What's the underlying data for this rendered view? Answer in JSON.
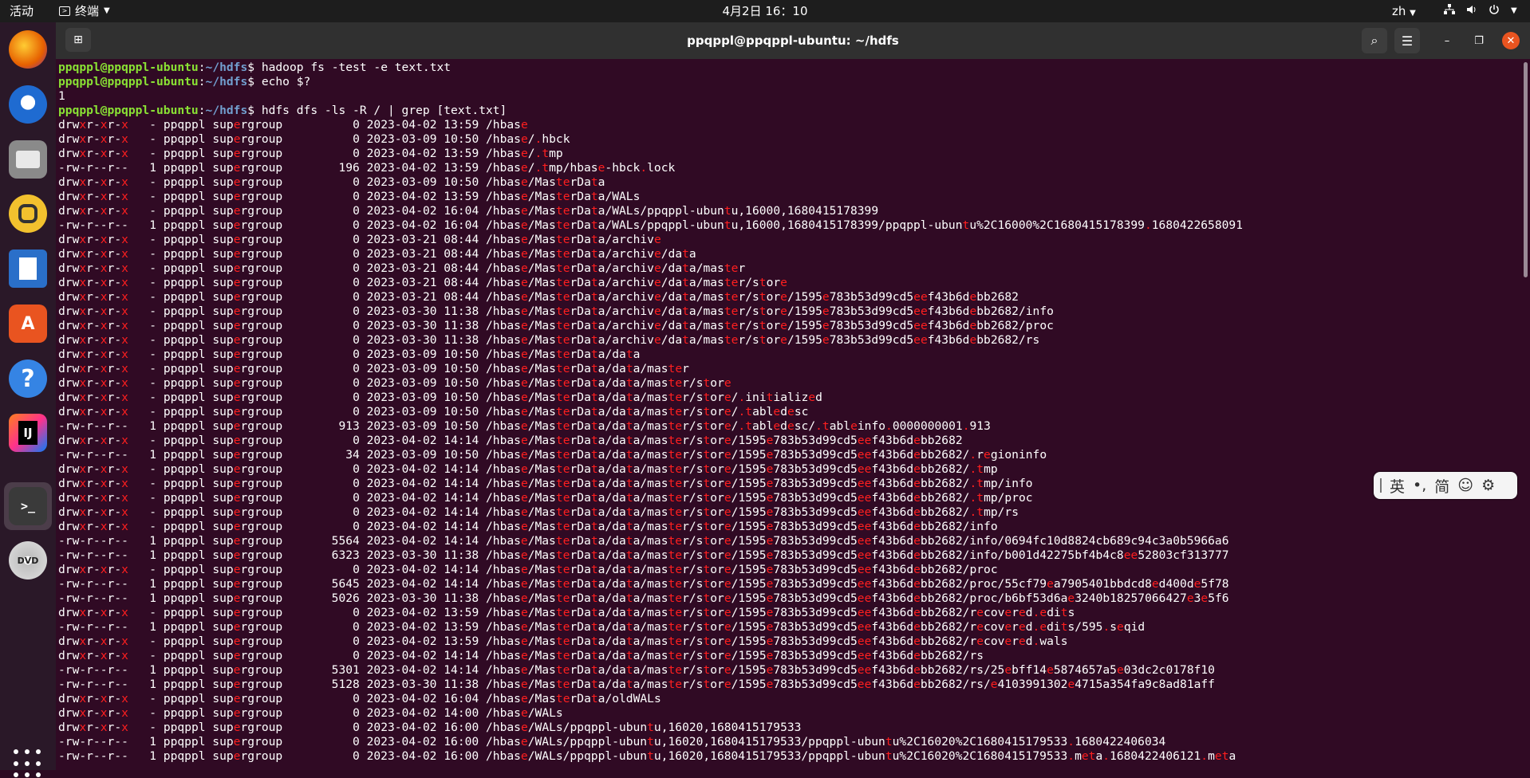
{
  "topbar": {
    "activities": "活动",
    "app_name": "终端",
    "clock": "4月2日 16：10",
    "lang": "zh",
    "tray_icons": [
      "network-icon",
      "volume-icon",
      "power-icon"
    ]
  },
  "dock": {
    "apps": [
      {
        "name": "firefox",
        "label": "",
        "color": "#e66000"
      },
      {
        "name": "thunderbird",
        "label": "",
        "color": "#1f6bd1"
      },
      {
        "name": "files",
        "label": "",
        "color": "#8a8a8a"
      },
      {
        "name": "rhythmbox",
        "label": "",
        "color": "#f2c12e"
      },
      {
        "name": "libreoffice-writer",
        "label": "",
        "color": "#2a6fc9"
      },
      {
        "name": "app-center",
        "label": "A",
        "color": "#e95420"
      },
      {
        "name": "help",
        "label": "?",
        "color": "#3584e4"
      },
      {
        "name": "intellij",
        "label": "IJ",
        "color": "#111111"
      },
      {
        "name": "terminal",
        "label": ">_",
        "color": "#3a3a3a"
      },
      {
        "name": "dvd",
        "label": "DVD",
        "color": "#bfbfbf"
      }
    ]
  },
  "window": {
    "title": "ppqppl@ppqppl-ubuntu: ~/hdfs",
    "buttons": {
      "minimize": "–",
      "maximize": "❐",
      "close": "✕",
      "search": "⌕",
      "menu": "☰",
      "new_tab": "⊞"
    }
  },
  "terminal": {
    "lines": [
      {
        "type": "prompt",
        "user": "ppqppl@ppqppl-ubuntu",
        "path": "~/hdfs",
        "cmd": "hadoop fs -test -e text.txt"
      },
      {
        "type": "prompt",
        "user": "ppqppl@ppqppl-ubuntu",
        "path": "~/hdfs",
        "cmd": "echo $?"
      },
      {
        "type": "out",
        "text": "1"
      },
      {
        "type": "prompt",
        "user": "ppqppl@ppqppl-ubuntu",
        "path": "~/hdfs",
        "cmd": "hdfs dfs -ls -R / | grep [text.txt]"
      },
      {
        "type": "out",
        "text": "drwxr-xr-x   - ppqppl supergroup          0 2023-04-02 13:59 /hbase"
      },
      {
        "type": "out",
        "text": "drwxr-xr-x   - ppqppl supergroup          0 2023-03-09 10:50 /hbase/.hbck"
      },
      {
        "type": "out",
        "text": "drwxr-xr-x   - ppqppl supergroup          0 2023-04-02 13:59 /hbase/.tmp"
      },
      {
        "type": "out",
        "text": "-rw-r--r--   1 ppqppl supergroup        196 2023-04-02 13:59 /hbase/.tmp/hbase-hbck.lock"
      },
      {
        "type": "out",
        "text": "drwxr-xr-x   - ppqppl supergroup          0 2023-03-09 10:50 /hbase/MasterData"
      },
      {
        "type": "out",
        "text": "drwxr-xr-x   - ppqppl supergroup          0 2023-04-02 13:59 /hbase/MasterData/WALs"
      },
      {
        "type": "out",
        "text": "drwxr-xr-x   - ppqppl supergroup          0 2023-04-02 16:04 /hbase/MasterData/WALs/ppqppl-ubuntu,16000,1680415178399"
      },
      {
        "type": "out",
        "text": "-rw-r--r--   1 ppqppl supergroup          0 2023-04-02 16:04 /hbase/MasterData/WALs/ppqppl-ubuntu,16000,1680415178399/ppqppl-ubuntu%2C16000%2C1680415178399.1680422658091"
      },
      {
        "type": "out",
        "text": "drwxr-xr-x   - ppqppl supergroup          0 2023-03-21 08:44 /hbase/MasterData/archive"
      },
      {
        "type": "out",
        "text": "drwxr-xr-x   - ppqppl supergroup          0 2023-03-21 08:44 /hbase/MasterData/archive/data"
      },
      {
        "type": "out",
        "text": "drwxr-xr-x   - ppqppl supergroup          0 2023-03-21 08:44 /hbase/MasterData/archive/data/master"
      },
      {
        "type": "out",
        "text": "drwxr-xr-x   - ppqppl supergroup          0 2023-03-21 08:44 /hbase/MasterData/archive/data/master/store"
      },
      {
        "type": "out",
        "text": "drwxr-xr-x   - ppqppl supergroup          0 2023-03-21 08:44 /hbase/MasterData/archive/data/master/store/1595e783b53d99cd5eef43b6debb2682"
      },
      {
        "type": "out",
        "text": "drwxr-xr-x   - ppqppl supergroup          0 2023-03-30 11:38 /hbase/MasterData/archive/data/master/store/1595e783b53d99cd5eef43b6debb2682/info"
      },
      {
        "type": "out",
        "text": "drwxr-xr-x   - ppqppl supergroup          0 2023-03-30 11:38 /hbase/MasterData/archive/data/master/store/1595e783b53d99cd5eef43b6debb2682/proc"
      },
      {
        "type": "out",
        "text": "drwxr-xr-x   - ppqppl supergroup          0 2023-03-30 11:38 /hbase/MasterData/archive/data/master/store/1595e783b53d99cd5eef43b6debb2682/rs"
      },
      {
        "type": "out",
        "text": "drwxr-xr-x   - ppqppl supergroup          0 2023-03-09 10:50 /hbase/MasterData/data"
      },
      {
        "type": "out",
        "text": "drwxr-xr-x   - ppqppl supergroup          0 2023-03-09 10:50 /hbase/MasterData/data/master"
      },
      {
        "type": "out",
        "text": "drwxr-xr-x   - ppqppl supergroup          0 2023-03-09 10:50 /hbase/MasterData/data/master/store"
      },
      {
        "type": "out",
        "text": "drwxr-xr-x   - ppqppl supergroup          0 2023-03-09 10:50 /hbase/MasterData/data/master/store/.initialized"
      },
      {
        "type": "out",
        "text": "drwxr-xr-x   - ppqppl supergroup          0 2023-03-09 10:50 /hbase/MasterData/data/master/store/.tabledesc"
      },
      {
        "type": "out",
        "text": "-rw-r--r--   1 ppqppl supergroup        913 2023-03-09 10:50 /hbase/MasterData/data/master/store/.tabledesc/.tableinfo.0000000001.913"
      },
      {
        "type": "out",
        "text": "drwxr-xr-x   - ppqppl supergroup          0 2023-04-02 14:14 /hbase/MasterData/data/master/store/1595e783b53d99cd5eef43b6debb2682"
      },
      {
        "type": "out",
        "text": "-rw-r--r--   1 ppqppl supergroup         34 2023-03-09 10:50 /hbase/MasterData/data/master/store/1595e783b53d99cd5eef43b6debb2682/.regioninfo"
      },
      {
        "type": "out",
        "text": "drwxr-xr-x   - ppqppl supergroup          0 2023-04-02 14:14 /hbase/MasterData/data/master/store/1595e783b53d99cd5eef43b6debb2682/.tmp"
      },
      {
        "type": "out",
        "text": "drwxr-xr-x   - ppqppl supergroup          0 2023-04-02 14:14 /hbase/MasterData/data/master/store/1595e783b53d99cd5eef43b6debb2682/.tmp/info"
      },
      {
        "type": "out",
        "text": "drwxr-xr-x   - ppqppl supergroup          0 2023-04-02 14:14 /hbase/MasterData/data/master/store/1595e783b53d99cd5eef43b6debb2682/.tmp/proc"
      },
      {
        "type": "out",
        "text": "drwxr-xr-x   - ppqppl supergroup          0 2023-04-02 14:14 /hbase/MasterData/data/master/store/1595e783b53d99cd5eef43b6debb2682/.tmp/rs"
      },
      {
        "type": "out",
        "text": "drwxr-xr-x   - ppqppl supergroup          0 2023-04-02 14:14 /hbase/MasterData/data/master/store/1595e783b53d99cd5eef43b6debb2682/info"
      },
      {
        "type": "out",
        "text": "-rw-r--r--   1 ppqppl supergroup       5564 2023-04-02 14:14 /hbase/MasterData/data/master/store/1595e783b53d99cd5eef43b6debb2682/info/0694fc10d8824cb689c94c3a0b5966a6"
      },
      {
        "type": "out",
        "text": "-rw-r--r--   1 ppqppl supergroup       6323 2023-03-30 11:38 /hbase/MasterData/data/master/store/1595e783b53d99cd5eef43b6debb2682/info/b001d42275bf4b4c8ee52803cf313777"
      },
      {
        "type": "out",
        "text": "drwxr-xr-x   - ppqppl supergroup          0 2023-04-02 14:14 /hbase/MasterData/data/master/store/1595e783b53d99cd5eef43b6debb2682/proc"
      },
      {
        "type": "out",
        "text": "-rw-r--r--   1 ppqppl supergroup       5645 2023-04-02 14:14 /hbase/MasterData/data/master/store/1595e783b53d99cd5eef43b6debb2682/proc/55cf79ea7905401bbdcd8ed400de5f78"
      },
      {
        "type": "out",
        "text": "-rw-r--r--   1 ppqppl supergroup       5026 2023-03-30 11:38 /hbase/MasterData/data/master/store/1595e783b53d99cd5eef43b6debb2682/proc/b6bf53d6ae3240b18257066427e3e5f6"
      },
      {
        "type": "out",
        "text": "drwxr-xr-x   - ppqppl supergroup          0 2023-04-02 13:59 /hbase/MasterData/data/master/store/1595e783b53d99cd5eef43b6debb2682/recovered.edits"
      },
      {
        "type": "out",
        "text": "-rw-r--r--   1 ppqppl supergroup          0 2023-04-02 13:59 /hbase/MasterData/data/master/store/1595e783b53d99cd5eef43b6debb2682/recovered.edits/595.seqid"
      },
      {
        "type": "out",
        "text": "drwxr-xr-x   - ppqppl supergroup          0 2023-04-02 13:59 /hbase/MasterData/data/master/store/1595e783b53d99cd5eef43b6debb2682/recovered.wals"
      },
      {
        "type": "out",
        "text": "drwxr-xr-x   - ppqppl supergroup          0 2023-04-02 14:14 /hbase/MasterData/data/master/store/1595e783b53d99cd5eef43b6debb2682/rs"
      },
      {
        "type": "out",
        "text": "-rw-r--r--   1 ppqppl supergroup       5301 2023-04-02 14:14 /hbase/MasterData/data/master/store/1595e783b53d99cd5eef43b6debb2682/rs/25ebff14e5874657a5e03dc2c0178f10"
      },
      {
        "type": "out",
        "text": "-rw-r--r--   1 ppqppl supergroup       5128 2023-03-30 11:38 /hbase/MasterData/data/master/store/1595e783b53d99cd5eef43b6debb2682/rs/e4103991302e4715a354fa9c8ad81aff"
      },
      {
        "type": "out",
        "text": "drwxr-xr-x   - ppqppl supergroup          0 2023-04-02 16:04 /hbase/MasterData/oldWALs"
      },
      {
        "type": "out",
        "text": "drwxr-xr-x   - ppqppl supergroup          0 2023-04-02 14:00 /hbase/WALs"
      },
      {
        "type": "out",
        "text": "drwxr-xr-x   - ppqppl supergroup          0 2023-04-02 16:00 /hbase/WALs/ppqppl-ubuntu,16020,1680415179533"
      },
      {
        "type": "out",
        "text": "-rw-r--r--   1 ppqppl supergroup          0 2023-04-02 16:00 /hbase/WALs/ppqppl-ubuntu,16020,1680415179533/ppqppl-ubuntu%2C16020%2C1680415179533.1680422406034"
      },
      {
        "type": "out",
        "text": "-rw-r--r--   1 ppqppl supergroup          0 2023-04-02 16:00 /hbase/WALs/ppqppl-ubuntu,16020,1680415179533/ppqppl-ubuntu%2C16020%2C1680415179533.meta.1680422406121.meta"
      }
    ],
    "highlight_chars": "text.",
    "highlight_color": "#ff1f1f",
    "prompt_user_color": "#8ae234",
    "prompt_path_color": "#729fcf",
    "background": "#300a24"
  },
  "ime": {
    "mode": "英",
    "punct": "•,",
    "script": "简",
    "emoji": "☺",
    "settings": "⚙"
  }
}
